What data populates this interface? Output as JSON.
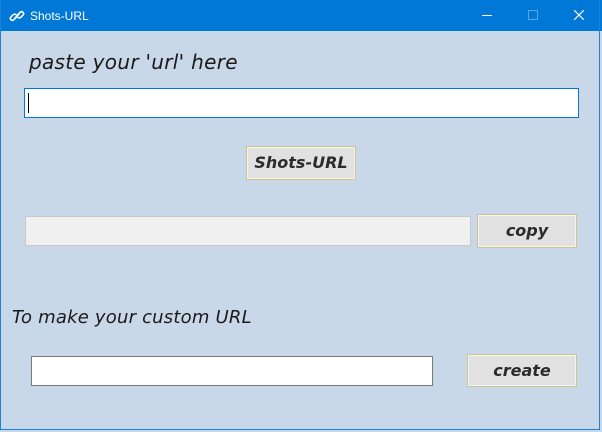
{
  "window": {
    "title": "Shots-URL",
    "icon": "link-icon",
    "title_bar_color": "#0078d7"
  },
  "controls": {
    "minimize_icon": "minimize-icon",
    "maximize_icon": "maximize-icon",
    "close_icon": "close-icon"
  },
  "main": {
    "paste_label": "paste your 'url' here",
    "url_input": {
      "value": "",
      "placeholder": ""
    },
    "shorten_button_label": "Shots-URL",
    "result_field": {
      "value": ""
    },
    "copy_button_label": "copy",
    "custom_label": "To make your custom URL",
    "custom_input": {
      "value": "",
      "placeholder": ""
    },
    "create_button_label": "create"
  },
  "colors": {
    "background": "#c8d8e8",
    "button_face": "#e1e1e1",
    "button_border": "#cfc48a"
  }
}
